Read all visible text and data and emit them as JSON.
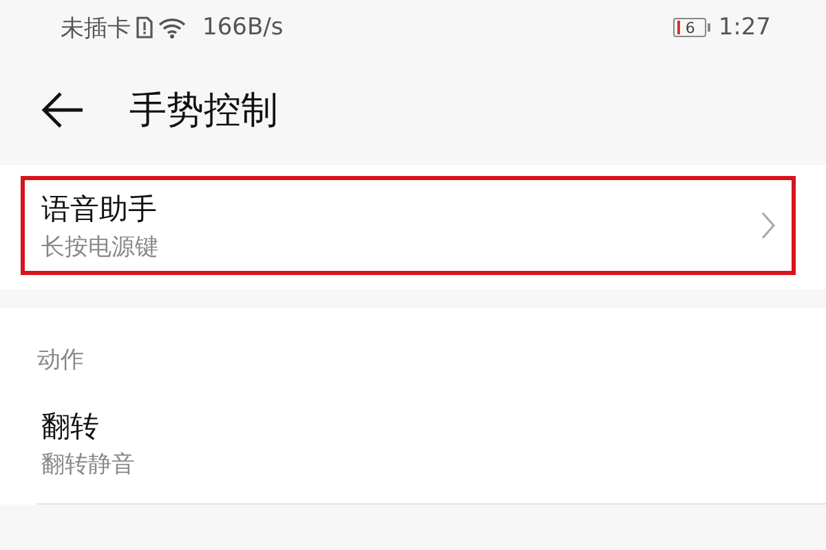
{
  "status_bar": {
    "carrier": "未插卡",
    "speed": "166B/s",
    "battery": "6",
    "time": "1:27"
  },
  "header": {
    "title": "手势控制"
  },
  "top_card": {
    "items": [
      {
        "title": "语音助手",
        "subtitle": "长按电源键",
        "highlighted": true,
        "chevron": true
      }
    ]
  },
  "section": {
    "heading": "动作",
    "items": [
      {
        "title": "翻转",
        "subtitle": "翻转静音",
        "highlighted": false,
        "chevron": false
      }
    ]
  }
}
